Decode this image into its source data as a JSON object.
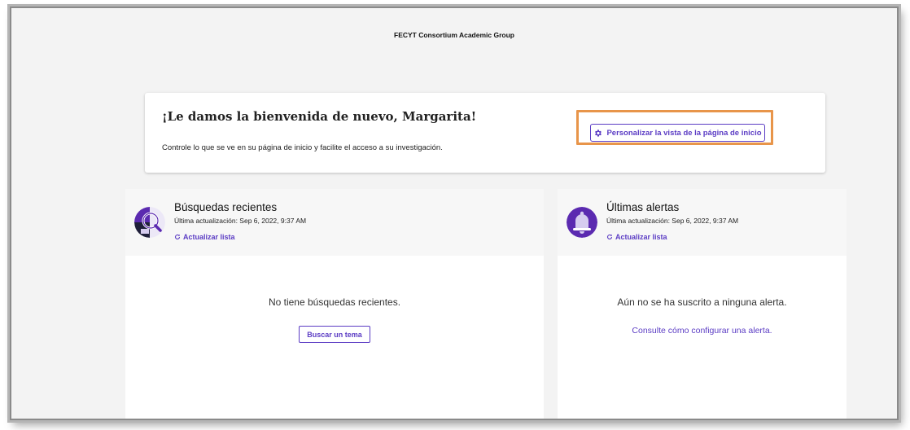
{
  "header": {
    "org_title": "FECYT Consortium Academic Group"
  },
  "welcome": {
    "title": "¡Le damos la bienvenida de nuevo, Margarita!",
    "subtitle": "Controle lo que se ve en su página de inicio y facilite el acceso a su investigación.",
    "customize_label": "Personalizar la vista de la página de inicio"
  },
  "recent_searches": {
    "title": "Búsquedas recientes",
    "updated": "Última actualización: Sep 6, 2022, 9:37 AM",
    "refresh_label": "Actualizar lista",
    "empty_text": "No tiene búsquedas recientes.",
    "button_label": "Buscar un tema"
  },
  "latest_alerts": {
    "title": "Últimas alertas",
    "updated": "Última actualización: Sep 6, 2022, 9:37 AM",
    "refresh_label": "Actualizar lista",
    "empty_text": "Aún no se ha suscrito a ninguna alerta.",
    "link_label": "Consulte cómo configurar una alerta."
  },
  "colors": {
    "accent": "#5b3cc4",
    "highlight": "#e8954a",
    "icon_purple": "#5b2ab0"
  },
  "icons": {
    "customize": "gear-icon",
    "refresh": "refresh-icon",
    "searches": "search-history-icon",
    "alerts": "bell-icon"
  }
}
